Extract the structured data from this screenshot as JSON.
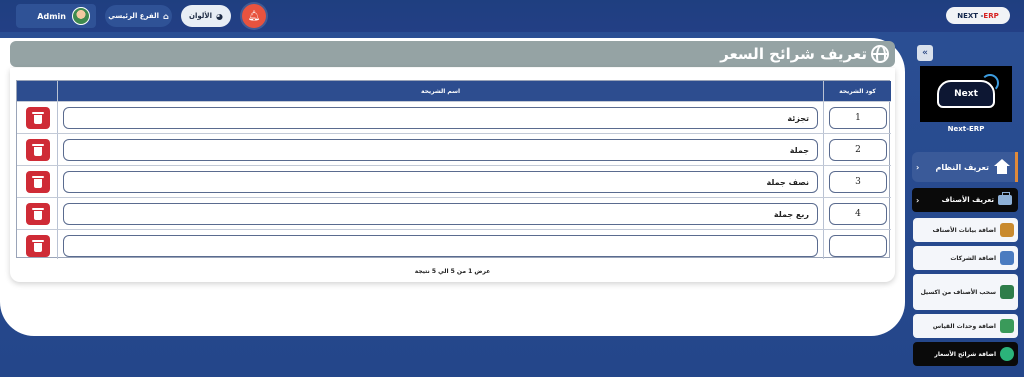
{
  "topbar": {
    "user_name": "Admin",
    "branch_label": "الفرع الرئيسي",
    "colors_label": "الألوان",
    "brand_next": "NEXT - ",
    "brand_erp": "ERP"
  },
  "page": {
    "title": "تعريف شرائح السعر"
  },
  "table": {
    "headers": {
      "name": "اسم الشريحة",
      "code": "كود الشريحة"
    },
    "rows": [
      {
        "code": "1",
        "name": "تجزئة"
      },
      {
        "code": "2",
        "name": "جملة"
      },
      {
        "code": "3",
        "name": "نصف جملة"
      },
      {
        "code": "4",
        "name": "ربع جملة"
      },
      {
        "code": "",
        "name": ""
      }
    ],
    "footer": "عرض 1 من 5 الي 5 نتيجة"
  },
  "sidebar": {
    "toggle": "«",
    "logo_text": "Next",
    "logo_caption": "Next-ERP",
    "main_item": "تعريف النظام",
    "sub_item": "تعريف الأصناف",
    "items": [
      {
        "label": "اضافة بيانات الأصناف",
        "icon": "bag-icon"
      },
      {
        "label": "اضافة الشركات",
        "icon": "building-icon"
      },
      {
        "label": "سحب الأصناف من اكسيل",
        "icon": "excel-icon"
      },
      {
        "label": "اضافة وحدات القياس",
        "icon": "chip-icon"
      },
      {
        "label": "اضافة شرائح الأسعار",
        "icon": "dollar-icon"
      }
    ],
    "colors": {
      "bag": "#c98a2e",
      "building": "#4a7bc0",
      "excel": "#2e7d4a",
      "chip": "#3a9a5a",
      "dollar": "#2bb37a"
    }
  }
}
